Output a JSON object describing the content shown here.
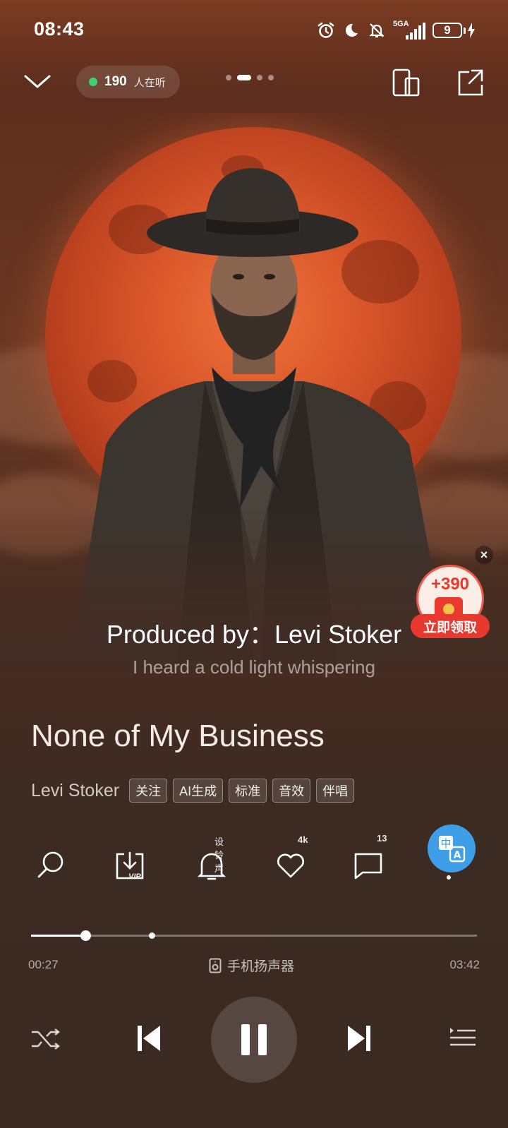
{
  "status_bar": {
    "time": "08:43",
    "network_label": "5GA",
    "battery_level": "9"
  },
  "header": {
    "listener_count": "190",
    "listener_label": "人在听",
    "page_count": 4,
    "active_page": 2
  },
  "lyrics": {
    "current": "Produced by：Levi Stoker",
    "next": "I heard a cold light whispering"
  },
  "red_packet": {
    "amount": "+390",
    "label": "立即领取"
  },
  "song": {
    "title": "None of My Business",
    "artist": "Levi Stoker",
    "tags": [
      "关注",
      "AI生成",
      "标准",
      "音效",
      "伴唱"
    ]
  },
  "actions": {
    "ringtone_label": "设铃声",
    "like_count": "4k",
    "comment_count": "13",
    "download_badge": "VIP",
    "translate_top": "中",
    "translate_bottom": "A"
  },
  "playback": {
    "elapsed": "00:27",
    "total": "03:42",
    "progress_fraction": 0.122,
    "marker_fraction": 0.27,
    "output_device": "手机扬声器"
  },
  "colors": {
    "accent_blue": "#3e9ee8",
    "red_packet": "#e8392f",
    "online_green": "#3fd36b"
  }
}
